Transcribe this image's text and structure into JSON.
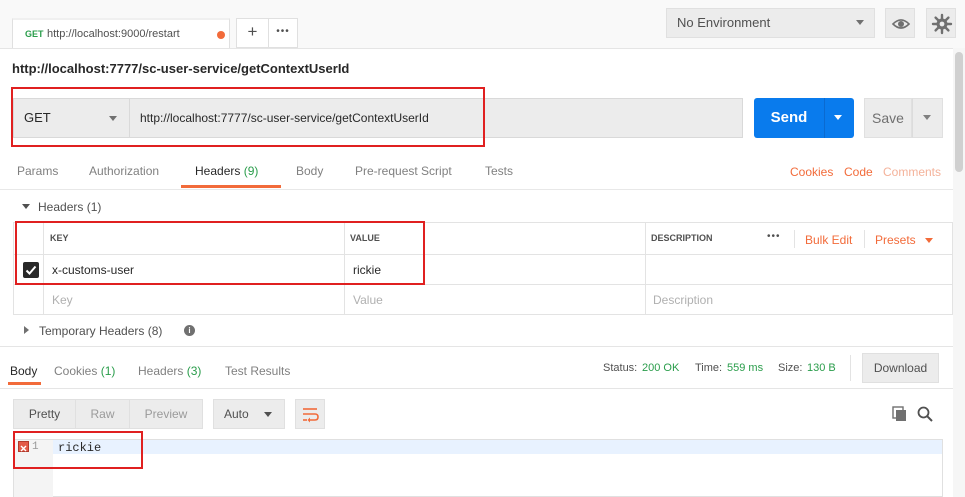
{
  "tab": {
    "method": "GET",
    "url": "http://localhost:9000/restart"
  },
  "tab_actions": {
    "add": "+",
    "more": "•••"
  },
  "environment": {
    "selected": "No Environment"
  },
  "request": {
    "title": "http://localhost:7777/sc-user-service/getContextUserId",
    "method": "GET",
    "url": "http://localhost:7777/sc-user-service/getContextUserId",
    "send_label": "Send",
    "save_label": "Save"
  },
  "request_tabs": [
    {
      "label": "Params"
    },
    {
      "label": "Authorization"
    },
    {
      "label": "Headers",
      "count": "(9)"
    },
    {
      "label": "Body"
    },
    {
      "label": "Pre-request Script"
    },
    {
      "label": "Tests"
    }
  ],
  "right_links": {
    "cookies": "Cookies",
    "code": "Code",
    "comments": "Comments"
  },
  "headers_section": {
    "title": "Headers (1)",
    "col_key": "KEY",
    "col_value": "VALUE",
    "col_description": "DESCRIPTION",
    "more": "•••",
    "bulk_edit": "Bulk Edit",
    "presets": "Presets",
    "rows": [
      {
        "key": "x-customs-user",
        "value": "rickie",
        "description": ""
      }
    ],
    "placeholder_key": "Key",
    "placeholder_value": "Value",
    "placeholder_description": "Description"
  },
  "temp_headers": {
    "title": "Temporary Headers (8)",
    "info": "i"
  },
  "response_tabs": [
    {
      "label": "Body"
    },
    {
      "label": "Cookies",
      "count": "(1)"
    },
    {
      "label": "Headers",
      "count": "(3)"
    },
    {
      "label": "Test Results"
    }
  ],
  "status": {
    "status_label": "Status:",
    "status_value": "200 OK",
    "time_label": "Time:",
    "time_value": "559 ms",
    "size_label": "Size:",
    "size_value": "130 B"
  },
  "download_label": "Download",
  "view_modes": [
    "Pretty",
    "Raw",
    "Preview"
  ],
  "format_select": "Auto",
  "code_lines": [
    {
      "number": "1",
      "text": "rickie"
    }
  ],
  "colors": {
    "accent": "#f26b3a",
    "send": "#097bed",
    "success": "#2a9d4b",
    "annotation": "#e02020"
  }
}
